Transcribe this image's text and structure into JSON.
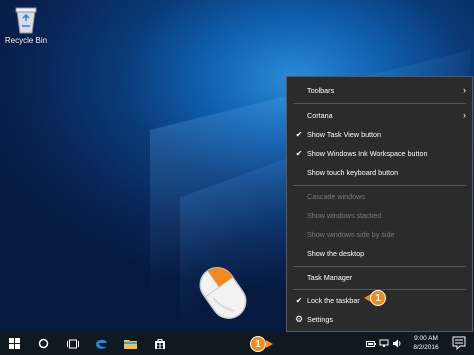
{
  "desktop": {
    "recycle_bin_label": "Recycle Bin"
  },
  "context_menu": {
    "items": [
      {
        "label": "Toolbars",
        "checked": false,
        "disabled": false,
        "submenu": true
      },
      {
        "label": "Cortana",
        "checked": false,
        "disabled": false,
        "submenu": true
      },
      {
        "label": "Show Task View button",
        "checked": true,
        "disabled": false
      },
      {
        "label": "Show Windows Ink Workspace button",
        "checked": true,
        "disabled": false
      },
      {
        "label": "Show touch keyboard button",
        "checked": false,
        "disabled": false
      },
      {
        "label": "Cascade windows",
        "checked": false,
        "disabled": true
      },
      {
        "label": "Show windows stacked",
        "checked": false,
        "disabled": true
      },
      {
        "label": "Show windows side by side",
        "checked": false,
        "disabled": true
      },
      {
        "label": "Show the desktop",
        "checked": false,
        "disabled": false
      },
      {
        "label": "Task Manager",
        "checked": false,
        "disabled": false
      },
      {
        "label": "Lock the taskbar",
        "checked": true,
        "disabled": false
      },
      {
        "label": "Settings",
        "checked": false,
        "disabled": false,
        "icon": "gear-icon"
      }
    ]
  },
  "callouts": {
    "menu_step": "1",
    "taskbar_step": "1"
  },
  "taskbar": {
    "icons": [
      "windows-start-icon",
      "cortana-search-icon",
      "task-view-icon",
      "edge-browser-icon",
      "file-explorer-icon",
      "store-icon"
    ],
    "time": "9:00 AM",
    "date": "8/2/2016"
  },
  "colors": {
    "accent_callout": "#f08a1e",
    "menu_background": "#2b2b2b",
    "taskbar_background": "#101820"
  }
}
